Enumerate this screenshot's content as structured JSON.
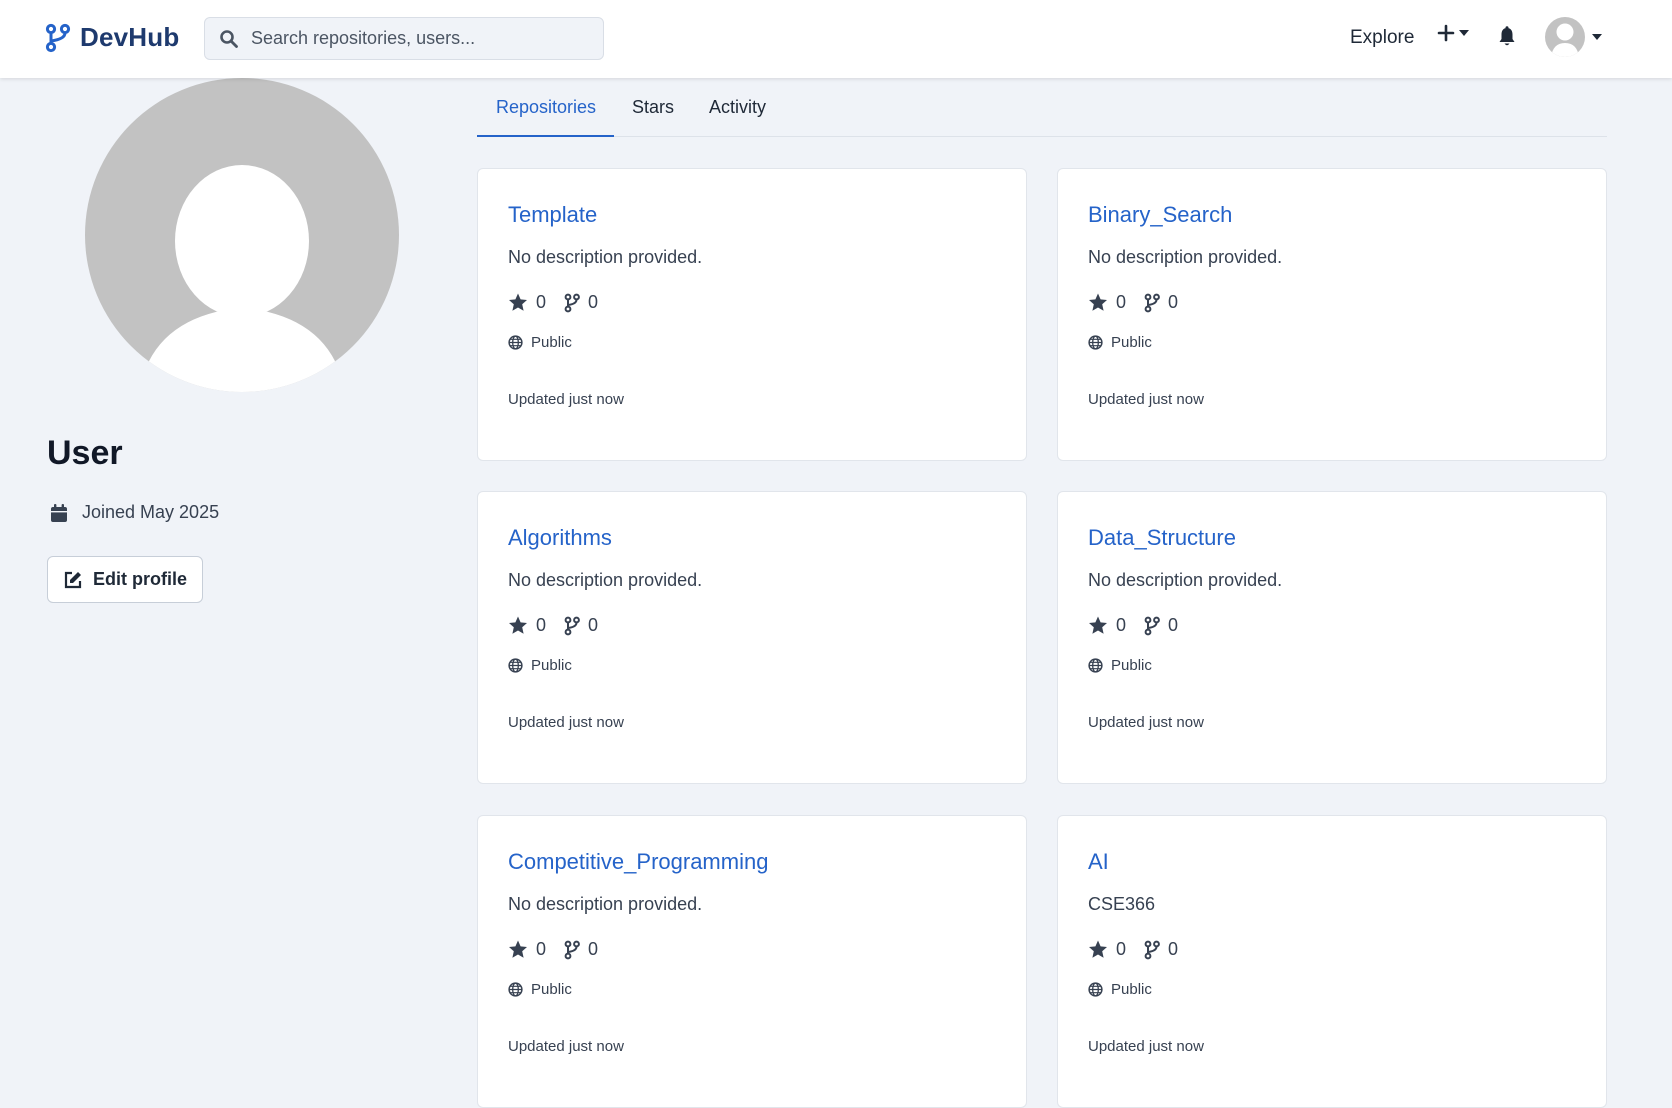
{
  "header": {
    "brand": "DevHub",
    "search_placeholder": "Search repositories, users...",
    "explore_label": "Explore",
    "icons": [
      "branch-logo-icon",
      "search-icon",
      "plus-icon",
      "caret-down-icon",
      "bell-icon",
      "avatar"
    ],
    "accent_color": "#2563c9"
  },
  "profile": {
    "name": "User",
    "joined": "Joined May 2025",
    "edit_label": "Edit profile"
  },
  "tabs": [
    {
      "label": "Repositories",
      "active": true
    },
    {
      "label": "Stars",
      "active": false
    },
    {
      "label": "Activity",
      "active": false
    }
  ],
  "repos": [
    {
      "name": "Template",
      "description": "No description provided.",
      "stars": "0",
      "forks": "0",
      "visibility": "Public",
      "updated": "Updated just now"
    },
    {
      "name": "Binary_Search",
      "description": "No description provided.",
      "stars": "0",
      "forks": "0",
      "visibility": "Public",
      "updated": "Updated just now"
    },
    {
      "name": "Algorithms",
      "description": "No description provided.",
      "stars": "0",
      "forks": "0",
      "visibility": "Public",
      "updated": "Updated just now"
    },
    {
      "name": "Data_Structure",
      "description": "No description provided.",
      "stars": "0",
      "forks": "0",
      "visibility": "Public",
      "updated": "Updated just now"
    },
    {
      "name": "Competitive_Programming",
      "description": "No description provided.",
      "stars": "0",
      "forks": "0",
      "visibility": "Public",
      "updated": "Updated just now"
    },
    {
      "name": "AI",
      "description": "CSE366",
      "stars": "0",
      "forks": "0",
      "visibility": "Public",
      "updated": "Updated just now"
    }
  ]
}
